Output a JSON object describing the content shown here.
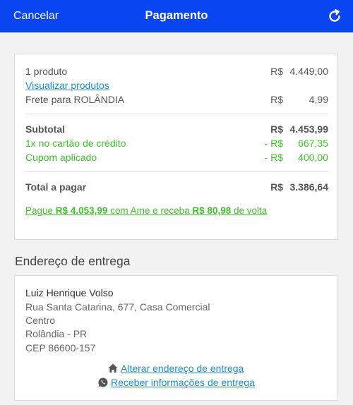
{
  "header": {
    "cancel_label": "Cancelar",
    "title": "Pagamento",
    "refresh_icon": "refresh-icon",
    "bg_color": "#0a45f2"
  },
  "summary": {
    "products": {
      "label": "1 produto",
      "currency": "R$",
      "amount": "4.449,00"
    },
    "view_products_label": "Visualizar produtos",
    "shipping": {
      "label": "Frete para ROLÂNDIA",
      "currency": "R$",
      "amount": "4,99"
    },
    "subtotal": {
      "label": "Subtotal",
      "currency": "R$",
      "amount": "4.453,99"
    },
    "card_discount": {
      "label": "1x no cartão de crédito",
      "currency": "- R$",
      "amount": "667,35"
    },
    "coupon": {
      "label": "Cupom aplicado",
      "currency": "- R$",
      "amount": "400,00"
    },
    "total": {
      "label": "Total a pagar",
      "currency": "R$",
      "amount": "3.386,64"
    },
    "promo": {
      "prefix": "Pague ",
      "pay_amount": "R$ 4.053,99",
      "middle": " com Ame e receba ",
      "cashback_amount": "R$ 80,98",
      "suffix": " de volta"
    },
    "accent_green": "#3fc22a",
    "link_blue": "#1a8fd4"
  },
  "delivery": {
    "section_title": "Endereço de entrega",
    "name": "Luiz Henrique Volso",
    "street": "Rua Santa Catarina, 677, Casa Comercial",
    "district": "Centro",
    "city": "Rolândia - PR",
    "zip": "CEP 86600-157",
    "change_address_label": "Alterar endereço de entrega",
    "change_address_icon": "home-icon",
    "receive_info_label": "Receber informações de entrega",
    "receive_info_icon": "whatsapp-icon"
  }
}
